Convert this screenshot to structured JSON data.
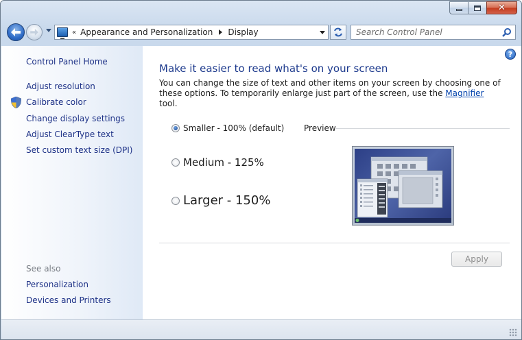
{
  "window": {
    "caption_buttons": [
      "minimize-icon",
      "maximize-icon",
      "close-icon"
    ]
  },
  "navbar": {
    "breadcrumb_prefix": "«",
    "breadcrumbs": [
      "Appearance and Personalization",
      "Display"
    ],
    "search_placeholder": "Search Control Panel"
  },
  "sidebar": {
    "home": "Control Panel Home",
    "links": [
      "Adjust resolution",
      "Calibrate color",
      "Change display settings",
      "Adjust ClearType text",
      "Set custom text size (DPI)"
    ],
    "see_also_label": "See also",
    "see_also_links": [
      "Personalization",
      "Devices and Printers"
    ]
  },
  "main": {
    "help_label": "?",
    "title": "Make it easier to read what's on your screen",
    "description_before": "You can change the size of text and other items on your screen by choosing one of these options. To temporarily enlarge just part of the screen, use the ",
    "description_link": "Magnifier",
    "description_after": " tool.",
    "options": [
      {
        "label": "Smaller - 100% (default)",
        "selected": true
      },
      {
        "label": "Medium - 125%",
        "selected": false
      },
      {
        "label": "Larger - 150%",
        "selected": false
      }
    ],
    "preview_label": "Preview",
    "apply_label": "Apply"
  },
  "colors": {
    "link": "#1e3287",
    "title": "#1d3a8d",
    "sidebar_bg": "#dfe9f6"
  }
}
